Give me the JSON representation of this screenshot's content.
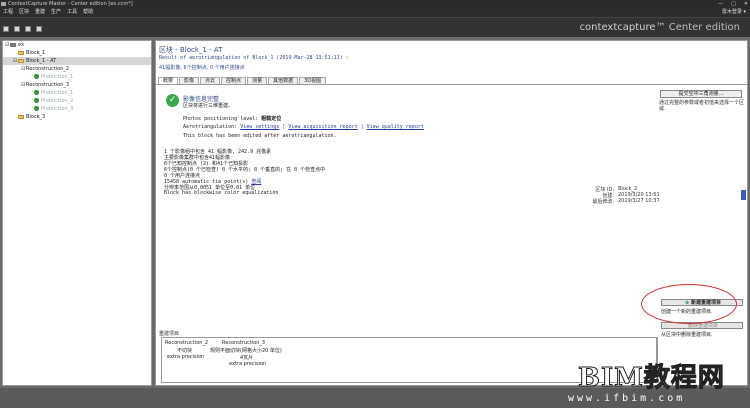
{
  "window": {
    "title": "ContextCapture Master - Center edition [ex.ccm*]",
    "controls": [
      "—",
      "□",
      "✕"
    ]
  },
  "menu": {
    "items": [
      "工程",
      "区块",
      "重建",
      "生产",
      "工具",
      "帮助"
    ],
    "user": "雷木登录 ▾"
  },
  "brand": {
    "name": "contextcapture",
    "tm": "™",
    "edition": "Center edition"
  },
  "tree": [
    {
      "label": "ex",
      "level": 0,
      "icon": "project-icon",
      "expander": "⊟",
      "state": "normal"
    },
    {
      "label": "Block_1",
      "level": 1,
      "icon": "folder-icon",
      "expander": "",
      "state": "normal"
    },
    {
      "label": "Block_1 - AT",
      "level": 1,
      "icon": "folder-icon",
      "expander": "⊟",
      "state": "selected"
    },
    {
      "label": "Reconstruction_2",
      "level": 2,
      "icon": "",
      "expander": "⊟",
      "state": "normal"
    },
    {
      "label": "Production_1",
      "level": 3,
      "icon": "ok-icon",
      "expander": "",
      "state": "faded"
    },
    {
      "label": "Reconstruction_3",
      "level": 2,
      "icon": "",
      "expander": "⊟",
      "state": "normal"
    },
    {
      "label": "Production_1",
      "level": 3,
      "icon": "ok-icon",
      "expander": "",
      "state": "faded"
    },
    {
      "label": "Production_2",
      "level": 3,
      "icon": "ok-icon",
      "expander": "",
      "state": "faded"
    },
    {
      "label": "Production_3",
      "level": 3,
      "icon": "ok-icon",
      "expander": "",
      "state": "faded"
    },
    {
      "label": "Block_3",
      "level": 1,
      "icon": "folder-icon",
      "expander": "",
      "state": "normal"
    }
  ],
  "header": {
    "breadcrumb": "区块 - Block_1 - AT",
    "result": "Result of aerotriangulation of Block_1 (2019-Mar-28 13:51:11)",
    "summary": "41幅影像, 6个控制点, 0 个用户连接点"
  },
  "tabs": [
    "概要",
    "影像",
    "点云",
    "控制点",
    "测量",
    "其他数据",
    "3D视图"
  ],
  "panel": {
    "status_title": "影像信息完整",
    "status_sub": "区块将进行三维重建。",
    "positioning_label": "Photos positioning level:",
    "positioning_value": "粗糙定位",
    "at_label": "Aerotriangulation:",
    "at_links": [
      "View settings",
      "View acquisition report",
      "View quality report"
    ],
    "edited_note": "This block has been edited after aerotriangulation.",
    "details": [
      "1 个影像组中包含 41 幅影像, 242.9 兆像素",
      "主要影像集群中包含41幅影像",
      "6个已知控制点 (2) 和41个已知投影",
      "6个控制点(0 个已检查) 0 个水平的; 0 个垂直的; 在 0 个检查点中",
      "0 个用户连接点",
      "15458 automatic tie point(s)",
      "分辨率范围从0.0051 单位至0.01 单位",
      "Block has blockwise color equalization"
    ],
    "tie_link": "查阅",
    "button_submit": "提交空中三角测量...",
    "submit_desc": "通过完整的参数或者初值来选择一个区域.",
    "block_id_label": "区块 ID:",
    "block_id_value": "Block_2",
    "created_label": "创建:",
    "created_value": "2019/3/20 13:51",
    "modified_label": "最后修改:",
    "modified_value": "2019/3/27 10:37"
  },
  "reconstructions": {
    "section_label": "重建项目",
    "columns": [
      {
        "name": "Reconstruction_2",
        "rows": [
          "不切块",
          "extra precision"
        ]
      },
      {
        "name": "Reconstruction_3",
        "rows": [
          "规则平面切块(网格大小20 单位)",
          "4瓦片",
          "extra precision"
        ]
      }
    ],
    "new_button": "新建重建项目",
    "new_desc": "创建一个新的重建项目.",
    "delete_button": "删除重建项目",
    "delete_desc": "从区块中删除重建项目."
  },
  "watermark": {
    "main": "BIM教程网",
    "url": "www.ifbim.com"
  }
}
